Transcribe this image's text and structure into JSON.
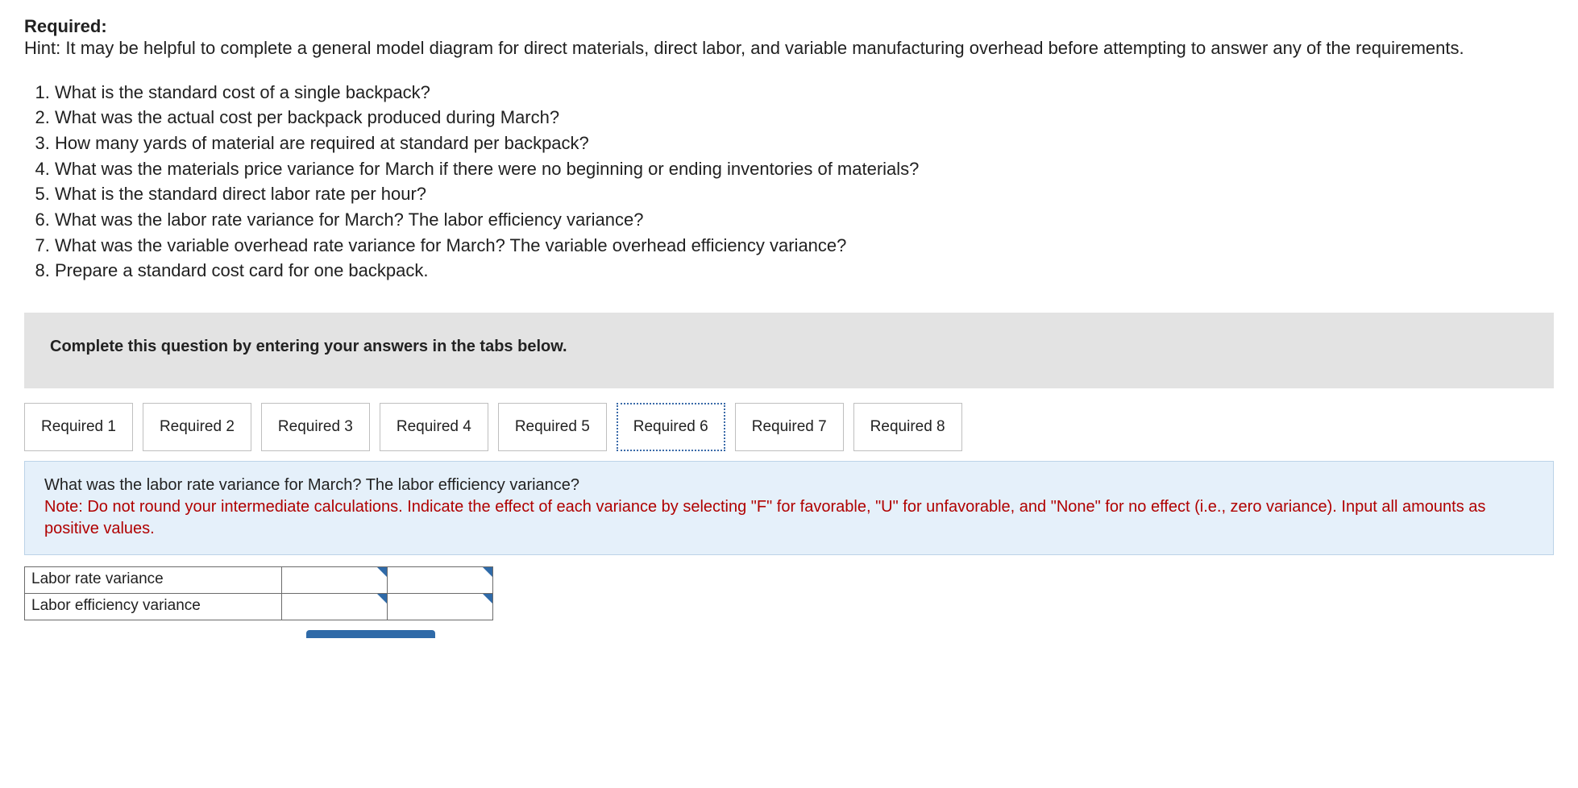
{
  "header": {
    "required_label": "Required:",
    "hint_prefix": "Hint:  ",
    "hint_text": "It may be helpful to complete a general model diagram for direct materials, direct labor, and variable manufacturing overhead before attempting to answer any of the requirements."
  },
  "questions": [
    "What is the standard cost of a single backpack?",
    "What was the actual cost per backpack produced during March?",
    "How many yards of material are required at standard per backpack?",
    "What was the materials price variance for March if there were no beginning or ending inventories of materials?",
    "What is the standard direct labor rate per hour?",
    "What was the labor rate variance for March? The labor efficiency variance?",
    "What was the variable overhead rate variance for March? The variable overhead efficiency variance?",
    "Prepare a standard cost card for one backpack."
  ],
  "banner": {
    "text": "Complete this question by entering your answers in the tabs below."
  },
  "tabs": [
    {
      "label": "Required 1",
      "active": false
    },
    {
      "label": "Required 2",
      "active": false
    },
    {
      "label": "Required 3",
      "active": false
    },
    {
      "label": "Required 4",
      "active": false
    },
    {
      "label": "Required 5",
      "active": false
    },
    {
      "label": "Required 6",
      "active": true
    },
    {
      "label": "Required 7",
      "active": false
    },
    {
      "label": "Required 8",
      "active": false
    }
  ],
  "panel": {
    "question": "What was the labor rate variance for March? The labor efficiency variance?",
    "note": "Note: Do not round your intermediate calculations. Indicate the effect of each variance by selecting \"F\" for favorable, \"U\" for unfavorable, and \"None\" for no effect (i.e., zero variance). Input all amounts as positive values."
  },
  "answer_rows": [
    {
      "label": "Labor rate variance",
      "amount": "",
      "effect": ""
    },
    {
      "label": "Labor efficiency variance",
      "amount": "",
      "effect": ""
    }
  ]
}
